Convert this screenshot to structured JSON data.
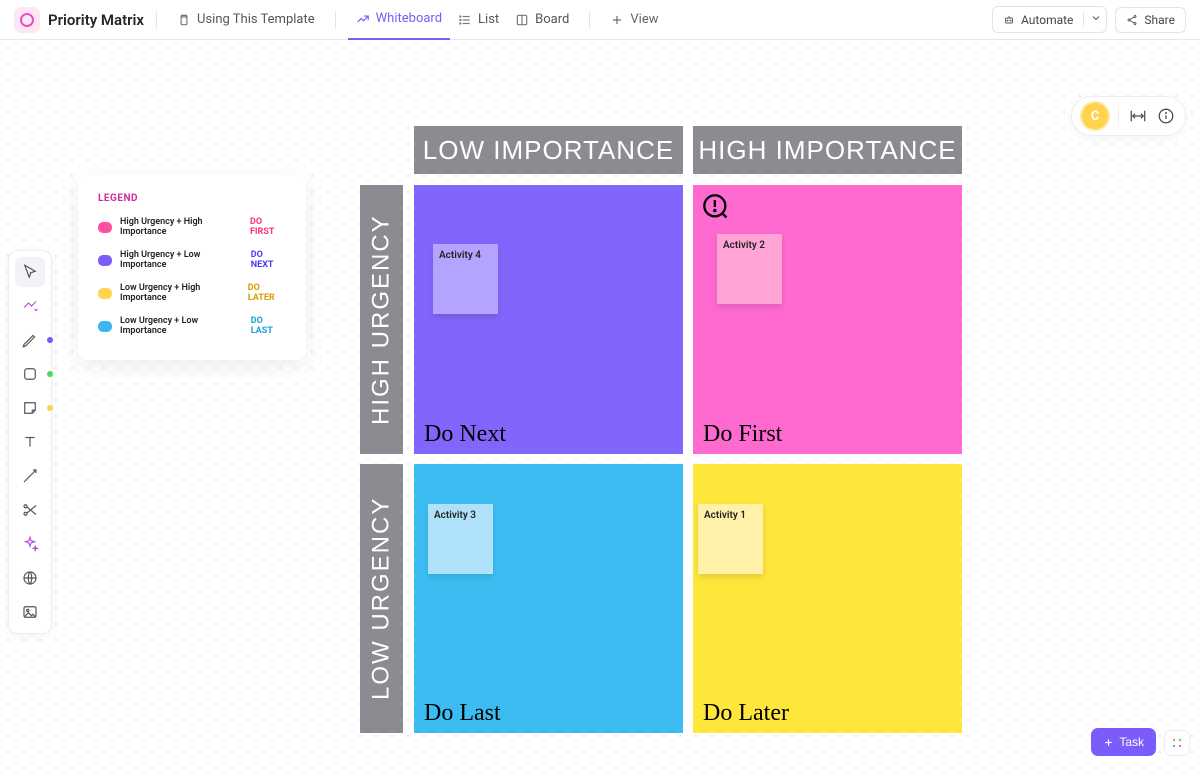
{
  "header": {
    "title": "Priority Matrix",
    "tabs": {
      "template": "Using This Template",
      "whiteboard": "Whiteboard",
      "list": "List",
      "board": "Board",
      "addview": "View"
    },
    "automate": "Automate",
    "share": "Share"
  },
  "toolbar": {
    "tools": [
      "select",
      "generate",
      "pen",
      "shape",
      "sticky",
      "text",
      "connector",
      "scissors",
      "sparkle",
      "web",
      "image"
    ],
    "pen_dot_color": "#6a5cff",
    "shape_dot_color": "#4cd964",
    "sticky_dot_color": "#ffd34e"
  },
  "floatright": {
    "avatar_initial": "C"
  },
  "legend": {
    "title": "LEGEND",
    "items": [
      {
        "swatch": "#ff4fa3",
        "text": "High Urgency + High Importance",
        "tag": "DO FIRST",
        "tag_color": "#ff2f7e"
      },
      {
        "swatch": "#7b5cfa",
        "text": "High Urgency + Low Importance",
        "tag": "DO NEXT",
        "tag_color": "#4b3df0"
      },
      {
        "swatch": "#ffd34e",
        "text": "Low Urgency + High Importance",
        "tag": "DO LATER",
        "tag_color": "#d89a00"
      },
      {
        "swatch": "#39b8ee",
        "text": "Low Urgency + Low Importance",
        "tag": "DO LAST",
        "tag_color": "#1aa0d8"
      }
    ]
  },
  "matrix": {
    "col_headers": {
      "low": "LOW IMPORTANCE",
      "high": "HIGH IMPORTANCE"
    },
    "row_headers": {
      "high": "HIGH URGENCY",
      "low": "LOW URGENCY"
    },
    "quadrants": {
      "do_next": {
        "bg": "#8265fb",
        "label": "Do Next",
        "note_bg": "#b4a4ff",
        "note_text": "Activity 4"
      },
      "do_first": {
        "bg": "#ff6ad0",
        "label": "Do First",
        "note_bg": "#ffa4d4",
        "note_text": "Activity 2"
      },
      "do_last": {
        "bg": "#3cbdf2",
        "label": "Do Last",
        "note_bg": "#b0e1fb",
        "note_text": "Activity 3"
      },
      "do_later": {
        "bg": "#ffe63b",
        "label": "Do Later",
        "note_bg": "#fff1a8",
        "note_text": "Activity 1"
      }
    }
  },
  "bottom": {
    "task": "Task"
  }
}
